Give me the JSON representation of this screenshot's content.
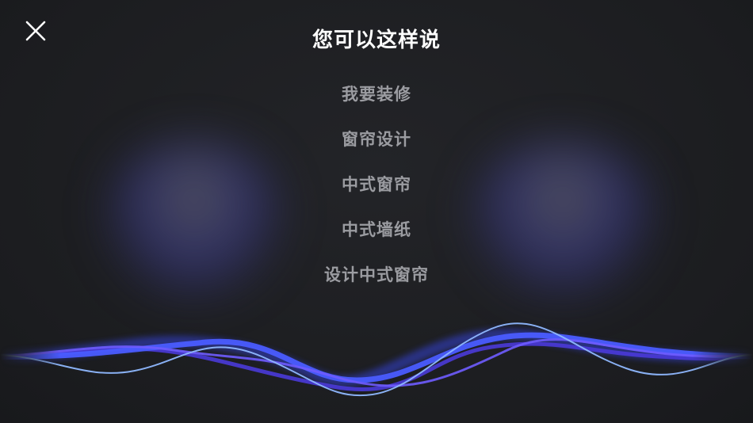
{
  "header": {
    "title": "您可以这样说",
    "close_icon": "close-icon"
  },
  "suggestions": [
    {
      "label": "我要装修"
    },
    {
      "label": "窗帘设计"
    },
    {
      "label": "中式窗帘"
    },
    {
      "label": "中式墙纸"
    },
    {
      "label": "设计中式窗帘"
    }
  ],
  "voice_wave": {
    "icon": "voice-waveform",
    "colors": [
      "#3b4bff",
      "#6f5cff",
      "#8fb8ff",
      "#4a3ad8"
    ]
  }
}
